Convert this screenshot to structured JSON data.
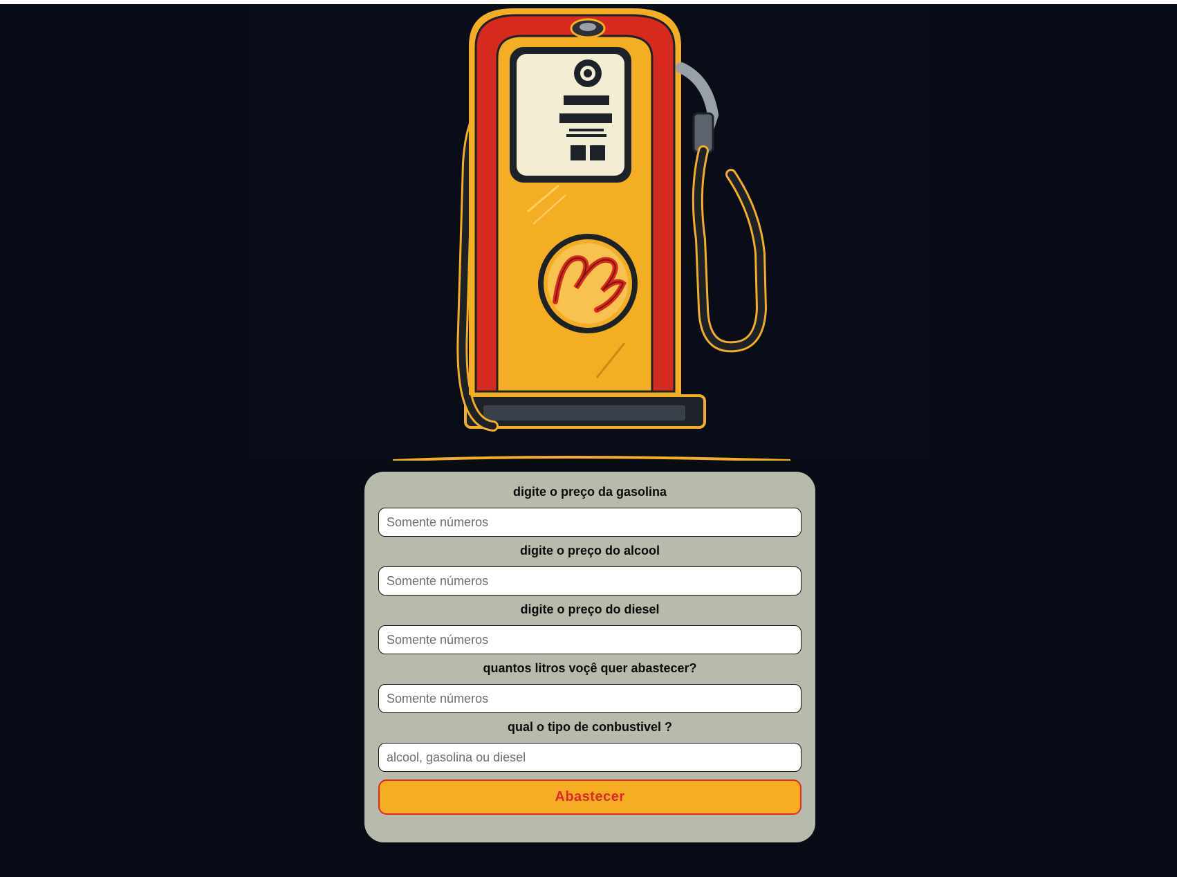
{
  "hero": {
    "illustration": "vintage-gas-pump-illustration",
    "colors": {
      "red": "#d72a1f",
      "yellow": "#f4ae24",
      "dark": "#1d2128",
      "cream": "#f3edd3"
    }
  },
  "form": {
    "fields": [
      {
        "label": "digite o preço da gasolina",
        "placeholder": "Somente números",
        "value": ""
      },
      {
        "label": "digite o preço do alcool",
        "placeholder": "Somente números",
        "value": ""
      },
      {
        "label": "digite o preço do diesel",
        "placeholder": "Somente números",
        "value": ""
      },
      {
        "label": "quantos litros voçê quer abastecer?",
        "placeholder": "Somente números",
        "value": ""
      },
      {
        "label": "qual o tipo de conbustivel ?",
        "placeholder": "alcool, gasolina ou diesel",
        "value": ""
      }
    ],
    "submit_label": "Abastecer",
    "colors": {
      "card": "#b7bbac",
      "button": "#f5ad23",
      "button_text": "#e3262a"
    }
  }
}
